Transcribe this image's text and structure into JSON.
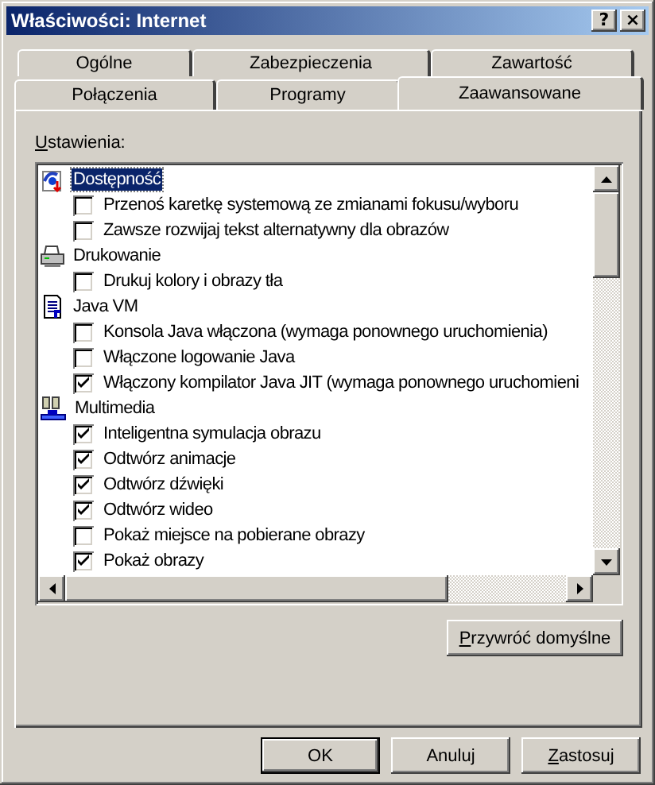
{
  "window": {
    "title": "Właściwości: Internet",
    "title_buttons": [
      {
        "label": "?"
      },
      {
        "label": "×"
      }
    ]
  },
  "tab_rows": [
    [
      {
        "label": "Ogólne",
        "selected": false
      },
      {
        "label": "Zabezpieczenia",
        "selected": false
      },
      {
        "label": "Zawartość",
        "selected": false
      }
    ],
    [
      {
        "label": "Połączenia",
        "selected": false
      },
      {
        "label": "Programy",
        "selected": false
      },
      {
        "label": "Zaawansowane",
        "selected": true
      }
    ]
  ],
  "settings_label": {
    "mnemonic": "U",
    "rest": "stawienia:"
  },
  "categories": [
    {
      "label": "Dostępność",
      "selected": true,
      "options": [
        {
          "label": "Przenoś karetkę systemową ze zmianami fokusu/wyboru",
          "checked": false
        },
        {
          "label": "Zawsze rozwijaj tekst alternatywny dla obrazów",
          "checked": false
        }
      ]
    },
    {
      "label": "Drukowanie",
      "selected": false,
      "options": [
        {
          "label": "Drukuj kolory i obrazy tła",
          "checked": false
        }
      ]
    },
    {
      "label": "Java VM",
      "selected": false,
      "options": [
        {
          "label": "Konsola Java włączona (wymaga ponownego uruchomienia)",
          "checked": false
        },
        {
          "label": "Włączone logowanie Java",
          "checked": false
        },
        {
          "label": "Włączony kompilator Java JIT (wymaga ponownego uruchomieni",
          "checked": true
        }
      ]
    },
    {
      "label": "Multimedia",
      "selected": false,
      "options": [
        {
          "label": "Inteligentna symulacja obrazu",
          "checked": true
        },
        {
          "label": "Odtwórz animacje",
          "checked": true
        },
        {
          "label": "Odtwórz dźwięki",
          "checked": true
        },
        {
          "label": "Odtwórz wideo",
          "checked": true
        },
        {
          "label": "Pokaż miejsce na pobierane obrazy",
          "checked": false
        },
        {
          "label": "Pokaż obrazy",
          "checked": true
        }
      ]
    }
  ],
  "restore_button": {
    "mnemonic": "P",
    "rest": "rzywróć domyślne"
  },
  "buttons": [
    {
      "kind": "default",
      "rest": "OK"
    },
    {
      "kind": "normal",
      "rest": "Anuluj"
    },
    {
      "kind": "normal",
      "mnemonic": "Z",
      "rest": "astosuj"
    }
  ]
}
